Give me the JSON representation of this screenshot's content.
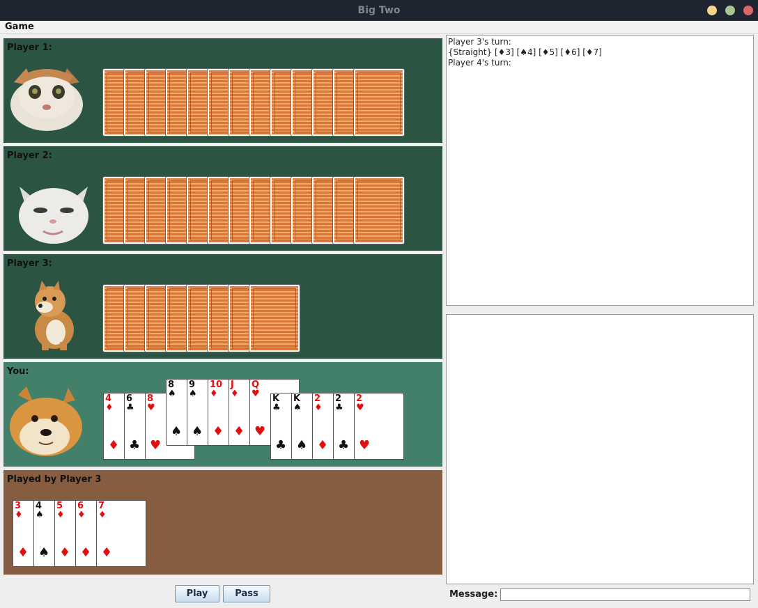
{
  "window": {
    "title": "Big Two"
  },
  "menu": {
    "game": "Game"
  },
  "players": [
    {
      "label": "Player 1:",
      "avatar_icon": "cat-avatar",
      "card_count": 13
    },
    {
      "label": "Player 2:",
      "avatar_icon": "cat-avatar",
      "card_count": 13
    },
    {
      "label": "Player 3:",
      "avatar_icon": "cheems-dog-avatar",
      "card_count": 8
    }
  ],
  "you": {
    "label": "You:",
    "avatar_icon": "doge-avatar",
    "cards": [
      {
        "rank": "4",
        "suit": "♦",
        "color": "red",
        "raised": false
      },
      {
        "rank": "6",
        "suit": "♣",
        "color": "blk",
        "raised": false
      },
      {
        "rank": "8",
        "suit": "♥",
        "color": "red",
        "raised": false
      },
      {
        "rank": "8",
        "suit": "♠",
        "color": "blk",
        "raised": true
      },
      {
        "rank": "9",
        "suit": "♠",
        "color": "blk",
        "raised": true
      },
      {
        "rank": "10",
        "suit": "♦",
        "color": "red",
        "raised": true
      },
      {
        "rank": "J",
        "suit": "♦",
        "color": "red",
        "raised": true
      },
      {
        "rank": "Q",
        "suit": "♥",
        "color": "red",
        "raised": true
      },
      {
        "rank": "K",
        "suit": "♣",
        "color": "blk",
        "raised": false
      },
      {
        "rank": "K",
        "suit": "♠",
        "color": "blk",
        "raised": false
      },
      {
        "rank": "2",
        "suit": "♦",
        "color": "red",
        "raised": false
      },
      {
        "rank": "2",
        "suit": "♣",
        "color": "blk",
        "raised": false
      },
      {
        "rank": "2",
        "suit": "♥",
        "color": "red",
        "raised": false
      }
    ]
  },
  "played": {
    "label": "Played by Player 3",
    "cards": [
      {
        "rank": "3",
        "suit": "♦",
        "color": "red"
      },
      {
        "rank": "4",
        "suit": "♠",
        "color": "blk"
      },
      {
        "rank": "5",
        "suit": "♦",
        "color": "red"
      },
      {
        "rank": "6",
        "suit": "♦",
        "color": "red"
      },
      {
        "rank": "7",
        "suit": "♦",
        "color": "red"
      }
    ]
  },
  "log": {
    "lines": [
      "Player 3's turn:",
      "{Straight} [♦3] [♠4] [♦5] [♦6] [♦7]",
      "Player 4's turn:"
    ]
  },
  "controls": {
    "play": "Play",
    "pass": "Pass",
    "message_label": "Message:",
    "message_value": ""
  },
  "colors": {
    "player_panel": "#2b5443",
    "you_panel": "#43806a",
    "played_panel": "#875d41"
  }
}
